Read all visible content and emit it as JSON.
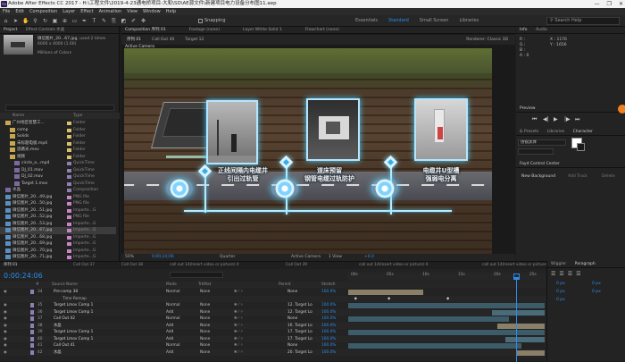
{
  "app": {
    "title": "Adobe After Effects CC 2017 - H:\\工程文件\\2019-4-23通电桥项目-大和\\SD\\AE源文件\\新建项目电力设备分布图11.aep",
    "window_buttons": [
      "—",
      "❐",
      "✕"
    ],
    "logo_text": "Ae"
  },
  "menu": [
    "File",
    "Edit",
    "Composition",
    "Layer",
    "Effect",
    "Animation",
    "View",
    "Window",
    "Help"
  ],
  "toolbar": {
    "snapping_label": "Snapping",
    "workspaces": [
      "Essentials",
      "Standard",
      "Small Screen",
      "Libraries"
    ],
    "active_workspace": "Standard",
    "search_placeholder": "Search Help"
  },
  "project": {
    "tabs": [
      "Project",
      "Effect Controls 水晶"
    ],
    "active_tab": "Project",
    "selected_name": "微信图片_20...67.jpg",
    "selected_uses": ", used 2 times",
    "selected_size": "6000 x 4000 (1.00)",
    "selected_colors": "Millions of Colors",
    "columns": [
      "Name",
      "Type"
    ],
    "items": [
      {
        "name": "广州地区智慧工...",
        "type": "Folder",
        "color": "#d8c16b",
        "indent": 0,
        "kind": "folder"
      },
      {
        "name": "comp",
        "type": "Folder",
        "color": "#d8c16b",
        "indent": 1,
        "kind": "folder"
      },
      {
        "name": "Solids",
        "type": "Folder",
        "color": "#d8c16b",
        "indent": 1,
        "kind": "folder"
      },
      {
        "name": "未标题电极.mp4",
        "type": "Folder",
        "color": "#d8c16b",
        "indent": 1,
        "kind": "folder"
      },
      {
        "name": "思路光.mov",
        "type": "Folder",
        "color": "#d8c16b",
        "indent": 1,
        "kind": "folder"
      },
      {
        "name": "视频",
        "type": "Folder",
        "color": "#d8c16b",
        "indent": 1,
        "kind": "folder"
      },
      {
        "name": "circle_a...mp4",
        "type": "QuickTime",
        "color": "#8e7fb5",
        "indent": 2,
        "kind": "file"
      },
      {
        "name": "DJ_01.mov",
        "type": "QuickTime",
        "color": "#8e7fb5",
        "indent": 2,
        "kind": "file"
      },
      {
        "name": "DJ_02.mov",
        "type": "QuickTime",
        "color": "#8e7fb5",
        "indent": 2,
        "kind": "file"
      },
      {
        "name": "Target 1.mov",
        "type": "QuickTime",
        "color": "#8e7fb5",
        "indent": 2,
        "kind": "file"
      },
      {
        "name": "水晶",
        "type": "Composition",
        "color": "#8e7fb5",
        "indent": 0,
        "kind": "comp"
      },
      {
        "name": "微信图片_20...49.jpg",
        "type": "PNG file",
        "color": "#c986c7",
        "indent": 0,
        "kind": "img"
      },
      {
        "name": "微信图片_20...50.jpg",
        "type": "PNG file",
        "color": "#c986c7",
        "indent": 0,
        "kind": "img"
      },
      {
        "name": "微信图片_20...51.jpg",
        "type": "Importe...G",
        "color": "#c986c7",
        "indent": 0,
        "kind": "img"
      },
      {
        "name": "微信图片_20...52.jpg",
        "type": "PNG file",
        "color": "#c986c7",
        "indent": 0,
        "kind": "img"
      },
      {
        "name": "微信图片_20...53.jpg",
        "type": "Importe...G",
        "color": "#c986c7",
        "indent": 0,
        "kind": "img"
      },
      {
        "name": "微信图片_20...67.jpg",
        "type": "Importe...G",
        "color": "#c986c7",
        "indent": 0,
        "kind": "img",
        "selected": true
      },
      {
        "name": "微信图片_20...68.jpg",
        "type": "Importe...G",
        "color": "#c986c7",
        "indent": 0,
        "kind": "img"
      },
      {
        "name": "微信图片_20...69.jpg",
        "type": "Importe...G",
        "color": "#c986c7",
        "indent": 0,
        "kind": "img"
      },
      {
        "name": "微信图片_20...70.jpg",
        "type": "Importe...G",
        "color": "#c986c7",
        "indent": 0,
        "kind": "img"
      },
      {
        "name": "微信图片_20...71.jpg",
        "type": "Importe...G",
        "color": "#c986c7",
        "indent": 0,
        "kind": "img"
      },
      {
        "name": "微信图片_20...72.jpg",
        "type": "Importe...G",
        "color": "#c986c7",
        "indent": 0,
        "kind": "img"
      },
      {
        "name": "微信图片_20...73.jpg",
        "type": "Importe...G",
        "color": "#c986c7",
        "indent": 0,
        "kind": "img"
      },
      {
        "name": "微信图片_20...74.jpg",
        "type": "Importe...G",
        "color": "#c986c7",
        "indent": 0,
        "kind": "img"
      }
    ],
    "footer_bpc": "8 bpc"
  },
  "composition": {
    "tabs": [
      "Composition 序列 01",
      "Footage (none)",
      "Layer White Solid 1",
      "Flowchart (none)"
    ],
    "subtabs": [
      "序列 01",
      "Call Out 40",
      "Target 12"
    ],
    "renderer": "Renderer:  Classic 3D",
    "view_label": "Active Camera",
    "captions": [
      "正线间隔内电缆井\n引出过轨管",
      "道床预留\n钢管电缆过轨防护",
      "电缆井U型槽\n强弱电分离"
    ],
    "controls": {
      "zoom": "50%",
      "timecode": "0;00;24;06",
      "quality": "Quarter",
      "camera": "Active Camera",
      "views": "1 View",
      "exposure": "+0.0"
    }
  },
  "info_panel": {
    "tabs": [
      "Info",
      "Audio"
    ],
    "r": "R :",
    "g": "G :",
    "b": "B :",
    "a": "A : 0",
    "x": "X : 1176",
    "y": "Y : 1656"
  },
  "preview": {
    "title": "Preview",
    "controls": [
      "⏮",
      "◀|",
      "▶",
      "|▶",
      "⏭"
    ]
  },
  "char_panel": {
    "tabs": [
      "& Presets",
      "Libraries",
      "Character"
    ],
    "font_name": "仿锐黑体",
    "tracker_title": "Fayd Control Center",
    "new_background": "New Background",
    "add_track": "Add Track",
    "delete": "Delete"
  },
  "timeline": {
    "tabs": [
      "序列 01",
      "Call Out 37",
      "Call Out 38",
      "call out 14(Insert video or picture) 4",
      "Call Out 39",
      "call out 14(Insert video or picture) 6",
      "call out 14(Insert video or picture) 5"
    ],
    "current_time": "0:00:24:06",
    "headers": [
      "#",
      "Source Name",
      "Mode",
      "TrkMat",
      "Parent",
      "Stretch"
    ],
    "ruler": [
      "00s",
      "05s",
      "10s",
      "15s",
      "20s",
      "25s"
    ],
    "layers": [
      {
        "num": "34",
        "name": "Pre-comp 38",
        "mode": "Normal",
        "trk": "None",
        "parent": "None",
        "stretch": "100.0%",
        "color": "#8e7fb5",
        "bar": [
          0.0,
          0.38
        ],
        "barcolor": "#8a7f68"
      },
      {
        "num": "",
        "name": "Time Remap",
        "mode": "",
        "trk": "",
        "parent": "",
        "stretch": "",
        "color": "",
        "bar": null,
        "barcolor": ""
      },
      {
        "num": "35",
        "name": "Target Lmov Comp 1",
        "mode": "Normal",
        "trk": "None",
        "parent": "12. Target Lo",
        "stretch": "100.0%",
        "color": "#8e7fb5",
        "bar": [
          0.0,
          1.0
        ],
        "barcolor": "#3d5c6a"
      },
      {
        "num": "36",
        "name": "Target Lmov Comp 1",
        "mode": "Add",
        "trk": "None",
        "parent": "12. Target Lo",
        "stretch": "100.0%",
        "color": "#8e7fb5",
        "bar": [
          0.73,
          1.0
        ],
        "barcolor": "#4a6b7a"
      },
      {
        "num": "37",
        "name": "Call Out 42",
        "mode": "Normal",
        "trk": "None",
        "parent": "None",
        "stretch": "100.0%",
        "color": "#8e7fb5",
        "bar": [
          0.0,
          0.82
        ],
        "barcolor": "#3d5c6a"
      },
      {
        "num": "38",
        "name": "水晶",
        "mode": "Add",
        "trk": "None",
        "parent": "16. Target Lo",
        "stretch": "100.0%",
        "color": "#8e7fb5",
        "bar": [
          0.76,
          1.0
        ],
        "barcolor": "#8a7f68"
      },
      {
        "num": "39",
        "name": "Target Lmov Comp 1",
        "mode": "Add",
        "trk": "None",
        "parent": "17. Target Lo",
        "stretch": "100.0%",
        "color": "#8e7fb5",
        "bar": [
          0.0,
          1.0
        ],
        "barcolor": "#3d5c6a"
      },
      {
        "num": "40",
        "name": "Target Lmov Comp 1",
        "mode": "Add",
        "trk": "None",
        "parent": "17. Target Lo",
        "stretch": "100.0%",
        "color": "#8e7fb5",
        "bar": [
          0.8,
          1.0
        ],
        "barcolor": "#4a6b7a"
      },
      {
        "num": "41",
        "name": "Call Out 41",
        "mode": "Normal",
        "trk": "None",
        "parent": "None",
        "stretch": "100.0%",
        "color": "#8e7fb5",
        "bar": [
          0.0,
          0.88
        ],
        "barcolor": "#3d5c6a"
      },
      {
        "num": "42",
        "name": "水晶",
        "mode": "Add",
        "trk": "None",
        "parent": "20. Target Lo",
        "stretch": "100.0%",
        "color": "#8e7fb5",
        "bar": [
          0.86,
          1.0
        ],
        "barcolor": "#8a7f68"
      }
    ]
  },
  "paragraph": {
    "tabs": [
      "Wiggler",
      "Paragraph"
    ],
    "active": "Paragraph",
    "px": [
      "0 px",
      "0 px",
      "0 px",
      "0 px",
      "0 px"
    ]
  }
}
